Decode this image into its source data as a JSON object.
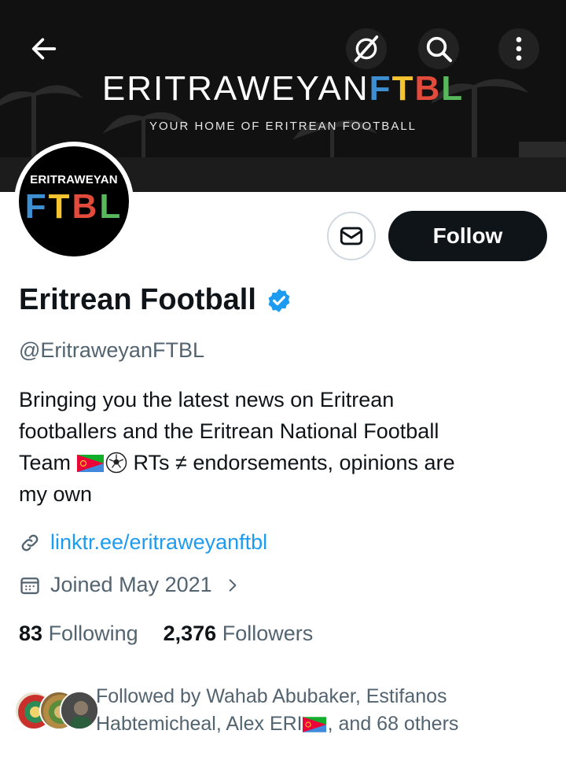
{
  "banner": {
    "title_main": "ERITRAWEYAN",
    "title_f": "F",
    "title_t": "T",
    "title_b": "B",
    "title_l": "L",
    "tagline": "YOUR HOME OF ERITREAN FOOTBALL"
  },
  "avatar": {
    "top_text": "ERITRAWEYAN",
    "ftbl": [
      "F",
      "T",
      "B",
      "L"
    ]
  },
  "actions": {
    "follow_label": "Follow"
  },
  "profile": {
    "name": "Eritrean Football",
    "handle": "@EritraweyanFTBL",
    "bio_line1": "Bringing you the latest news on Eritrean",
    "bio_line2": "footballers and the Eritrean National Football",
    "bio_line3_start": "Team",
    "bio_line3_end": "RTs ≠ endorsements, opinions are",
    "bio_line4": "my own",
    "link": "linktr.ee/eritraweyanftbl",
    "joined": "Joined May 2021"
  },
  "stats": {
    "following_count": "83",
    "following_label": "Following",
    "followers_count": "2,376",
    "followers_label": "Followers"
  },
  "followed_by": {
    "line1": "Followed by Wahab Abubaker, Estifanos",
    "line2_start": "Habtemicheal, Alex ERI",
    "line2_end": ", and 68 others"
  },
  "colors": {
    "accent": "#1d9bf0",
    "text_primary": "#0f1419",
    "text_secondary": "#536471"
  },
  "icons": {
    "back": "arrow-left-icon",
    "grok": "grok-icon",
    "search": "search-icon",
    "more": "more-vertical-icon",
    "message": "envelope-icon",
    "verified": "verified-badge-icon",
    "link": "link-icon",
    "calendar": "calendar-icon"
  }
}
